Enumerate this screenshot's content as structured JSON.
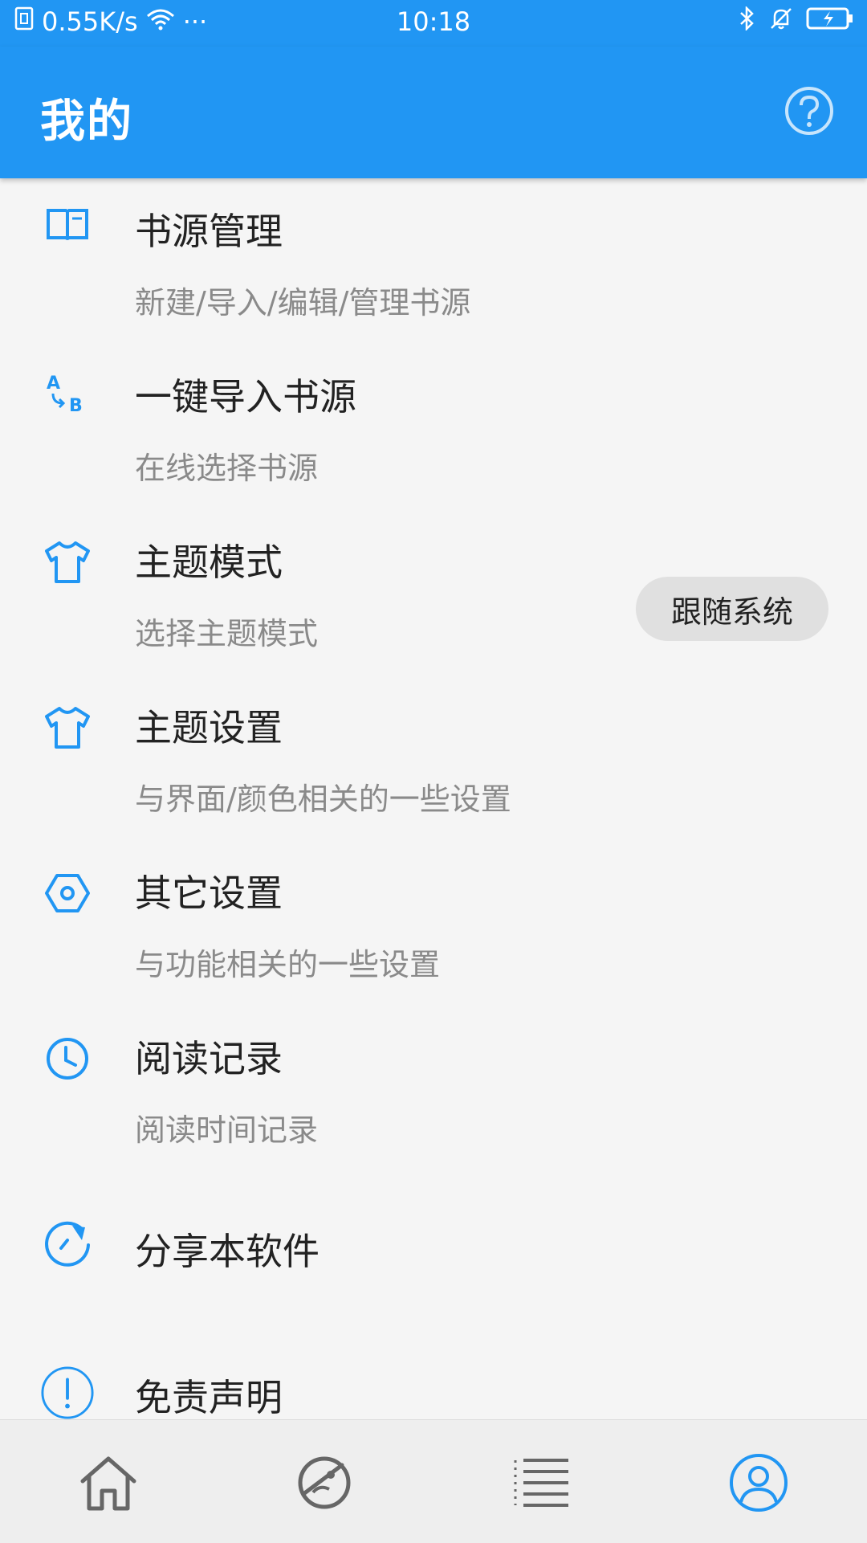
{
  "status_bar": {
    "speed": "0.55K/s",
    "more": "···",
    "time": "10:18"
  },
  "app_bar": {
    "title": "我的",
    "help_icon": "question-circle-icon"
  },
  "colors": {
    "primary": "#2196f3",
    "background": "#f5f5f5",
    "chip": "#e0e0e0"
  },
  "menu": {
    "items": [
      {
        "title": "书源管理",
        "subtitle": "新建/导入/编辑/管理书源",
        "icon": "book-icon"
      },
      {
        "title": "一键导入书源",
        "subtitle": "在线选择书源",
        "icon": "translate-ab-icon"
      },
      {
        "title": "主题模式",
        "subtitle": "选择主题模式",
        "icon": "tshirt-icon",
        "value": "跟随系统"
      },
      {
        "title": "主题设置",
        "subtitle": "与界面/颜色相关的一些设置",
        "icon": "tshirt-icon"
      },
      {
        "title": "其它设置",
        "subtitle": "与功能相关的一些设置",
        "icon": "settings-hex-icon"
      },
      {
        "title": "阅读记录",
        "subtitle": "阅读时间记录",
        "icon": "clock-icon"
      },
      {
        "title": "分享本软件",
        "icon": "share-refresh-icon"
      },
      {
        "title": "免责声明",
        "icon": "exclamation-circle-icon"
      }
    ]
  },
  "bottom_nav": {
    "items": [
      {
        "icon": "home-icon",
        "active": false
      },
      {
        "icon": "explore-icon",
        "active": false
      },
      {
        "icon": "list-icon",
        "active": false
      },
      {
        "icon": "profile-icon",
        "active": true
      }
    ]
  }
}
